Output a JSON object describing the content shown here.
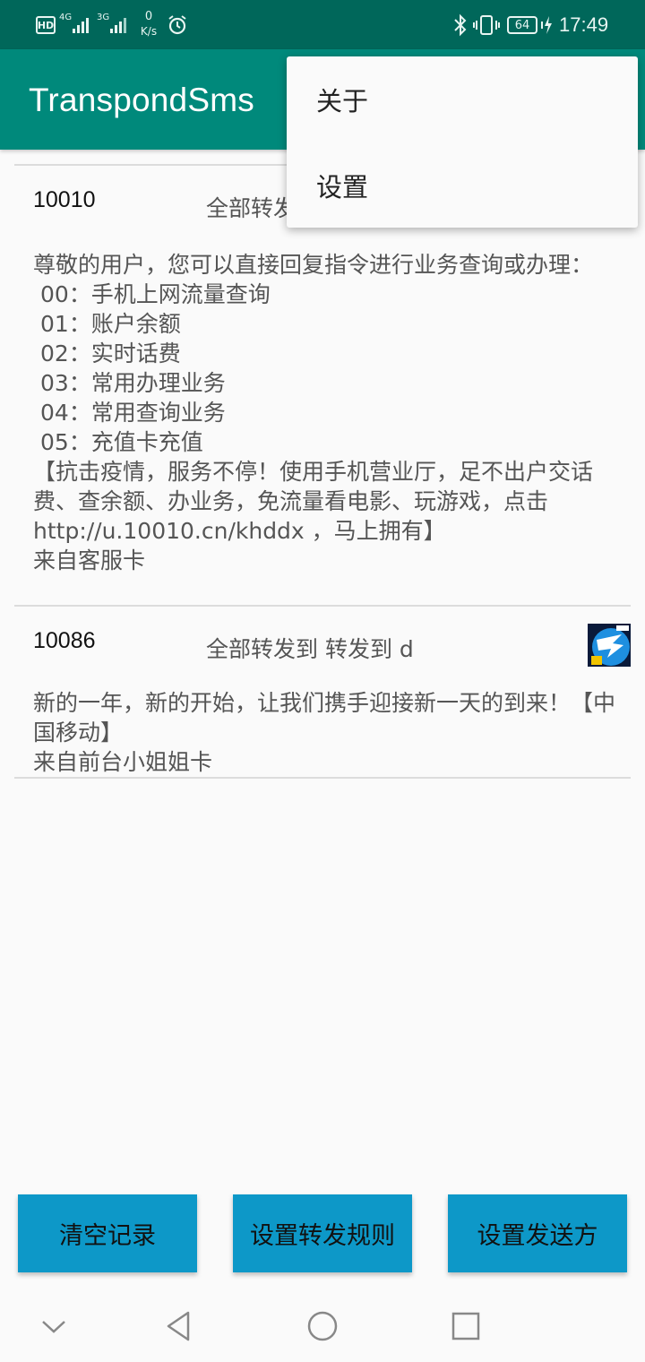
{
  "status_bar": {
    "hd": "HD",
    "sim1": "4G",
    "sim2": "3G",
    "net_speed_value": "0",
    "net_speed_unit": "K/s",
    "battery": "64",
    "time": "17:49"
  },
  "app_bar": {
    "title": "TranspondSms"
  },
  "menu": {
    "items": [
      {
        "label": "关于"
      },
      {
        "label": "设置"
      }
    ]
  },
  "messages": [
    {
      "sender": "10010",
      "rule": "全部转发",
      "body": "尊敬的用户，您可以直接回复指令进行业务查询或办理：\n 00：手机上网流量查询\n 01：账户余额\n 02：实时话费\n 03：常用办理业务\n 04：常用查询业务\n 05：充值卡充值\n【抗击疫情，服务不停！使用手机营业厅，足不出户交话费、查余额、办业务，免流量看电影、玩游戏，点击 http://u.10010.cn/khddx ，马上拥有】\n来自客服卡"
    },
    {
      "sender": "10086",
      "rule": "全部转发到  转发到 d",
      "body": "新的一年，新的开始，让我们携手迎接新一天的到来！【中国移动】\n来自前台小姐姐卡"
    }
  ],
  "buttons": {
    "clear": "清空记录",
    "set_rules": "设置转发规则",
    "set_senders": "设置发送方"
  },
  "colors": {
    "status_bar": "#00675a",
    "app_bar": "#00897b",
    "button": "#0d98c8"
  }
}
